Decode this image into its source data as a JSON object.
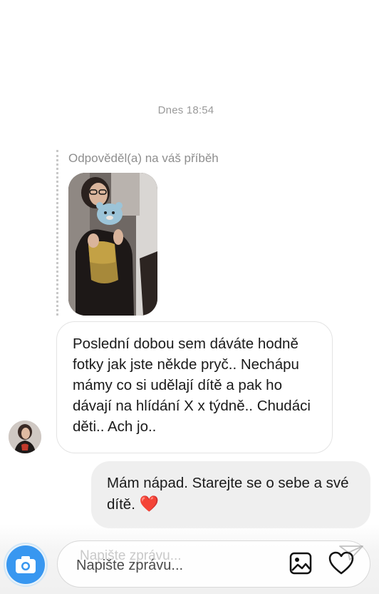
{
  "conversation": {
    "timestamp": "Dnes 18:54",
    "story_reply_label": "Odpověděl(a) na váš příběh",
    "incoming_message": "Poslední dobou sem dáváte hodně fotky jak jste někde pryč.. Nechápu mámy co si udělají dítě a pak ho dávají na hlídání X x týdně.. Chudáci děti.. Ach jo..",
    "outgoing_message": "Mám nápad. Starejte se o sebe a své dítě.",
    "outgoing_emoji": "❤️"
  },
  "composer": {
    "ghost_placeholder": "Napište zprávu...",
    "placeholder": "Napište zprávu...",
    "value": ""
  },
  "icons": {
    "camera": "camera-icon",
    "gallery": "gallery-icon",
    "heart": "heart-icon",
    "send": "send-icon"
  },
  "colors": {
    "accent_blue": "#3897f0",
    "outgoing_bubble": "#efefef",
    "incoming_border": "#e3e3e3",
    "heart_red": "#e0245e"
  }
}
